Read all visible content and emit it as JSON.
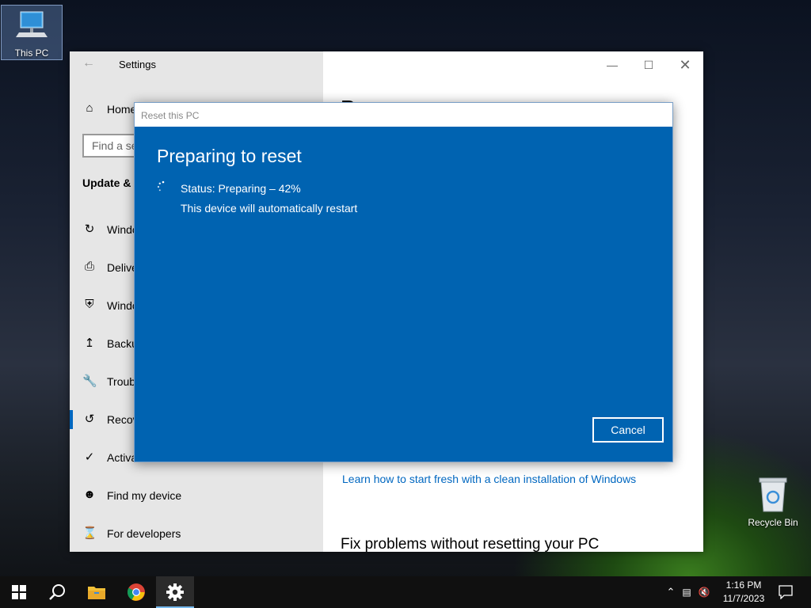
{
  "desktop": {
    "icons": [
      {
        "label": "This PC",
        "icon": "computer-icon"
      },
      {
        "label": "Recycle Bin",
        "icon": "recycle-bin-icon"
      }
    ]
  },
  "settings": {
    "title": "Settings",
    "nav": {
      "home": "Home",
      "search_placeholder": "Find a se",
      "section": "Update & ",
      "items": [
        {
          "label": "Windo",
          "icon": "refresh-icon"
        },
        {
          "label": "Delive",
          "icon": "delivery-icon"
        },
        {
          "label": "Windo",
          "icon": "shield-icon"
        },
        {
          "label": "Backu",
          "icon": "backup-icon"
        },
        {
          "label": "Troub",
          "icon": "wrench-icon"
        },
        {
          "label": "Recov",
          "icon": "recovery-icon",
          "selected": true
        },
        {
          "label": "Activa",
          "icon": "check-circle-icon"
        },
        {
          "label": "Find my device",
          "icon": "person-icon"
        },
        {
          "label": "For developers",
          "icon": "developer-icon"
        }
      ]
    },
    "content": {
      "heading": "R",
      "link": "Learn how to start fresh with a clean installation of Windows",
      "fix_heading": "Fix problems without resetting your PC"
    }
  },
  "dialog": {
    "title": "Reset this PC",
    "heading": "Preparing to reset",
    "status": "Status: Preparing – 42%",
    "progress_percent": 42,
    "subtext": "This device will automatically restart",
    "cancel": "Cancel",
    "accent_color": "#0063b1"
  },
  "taskbar": {
    "apps": [
      "start-icon",
      "search-icon",
      "file-explorer-icon",
      "chrome-icon",
      "settings-gear-icon"
    ],
    "time": "1:16 PM",
    "date": "11/7/2023"
  }
}
